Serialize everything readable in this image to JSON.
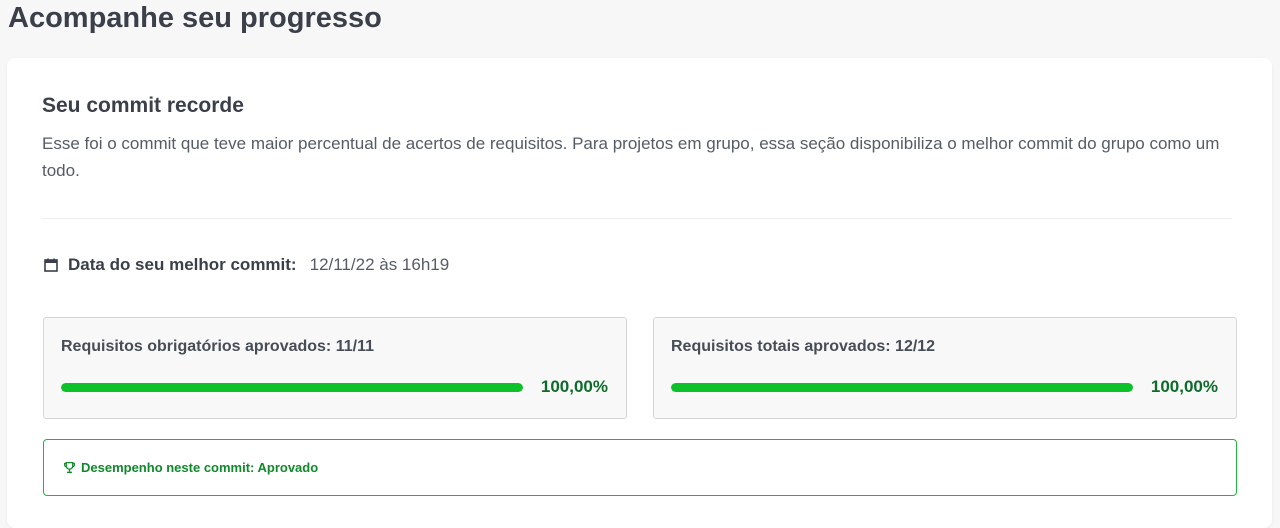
{
  "header": {
    "title": "Acompanhe seu progresso"
  },
  "record": {
    "title": "Seu commit recorde",
    "description": "Esse foi o commit que teve maior percentual de acertos de requisitos. Para projetos em grupo, essa seção disponibiliza o melhor commit do grupo como um todo.",
    "date_label": "Data do seu melhor commit:",
    "date_value": "12/11/22 às 16h19",
    "date_icon": "calendar-icon"
  },
  "requirements": [
    {
      "title": "Requisitos obrigatórios aprovados: 11/11",
      "percent_text": "100,00%",
      "progress": 1.0
    },
    {
      "title": "Requisitos totais aprovados: 12/12",
      "percent_text": "100,00%",
      "progress": 1.0
    }
  ],
  "performance": {
    "text": "Desempenho neste commit: Aprovado",
    "icon": "trophy-icon"
  },
  "colors": {
    "progress": "#0dc12b",
    "success_text": "#0f8a2a",
    "success_border": "#22b43d"
  }
}
